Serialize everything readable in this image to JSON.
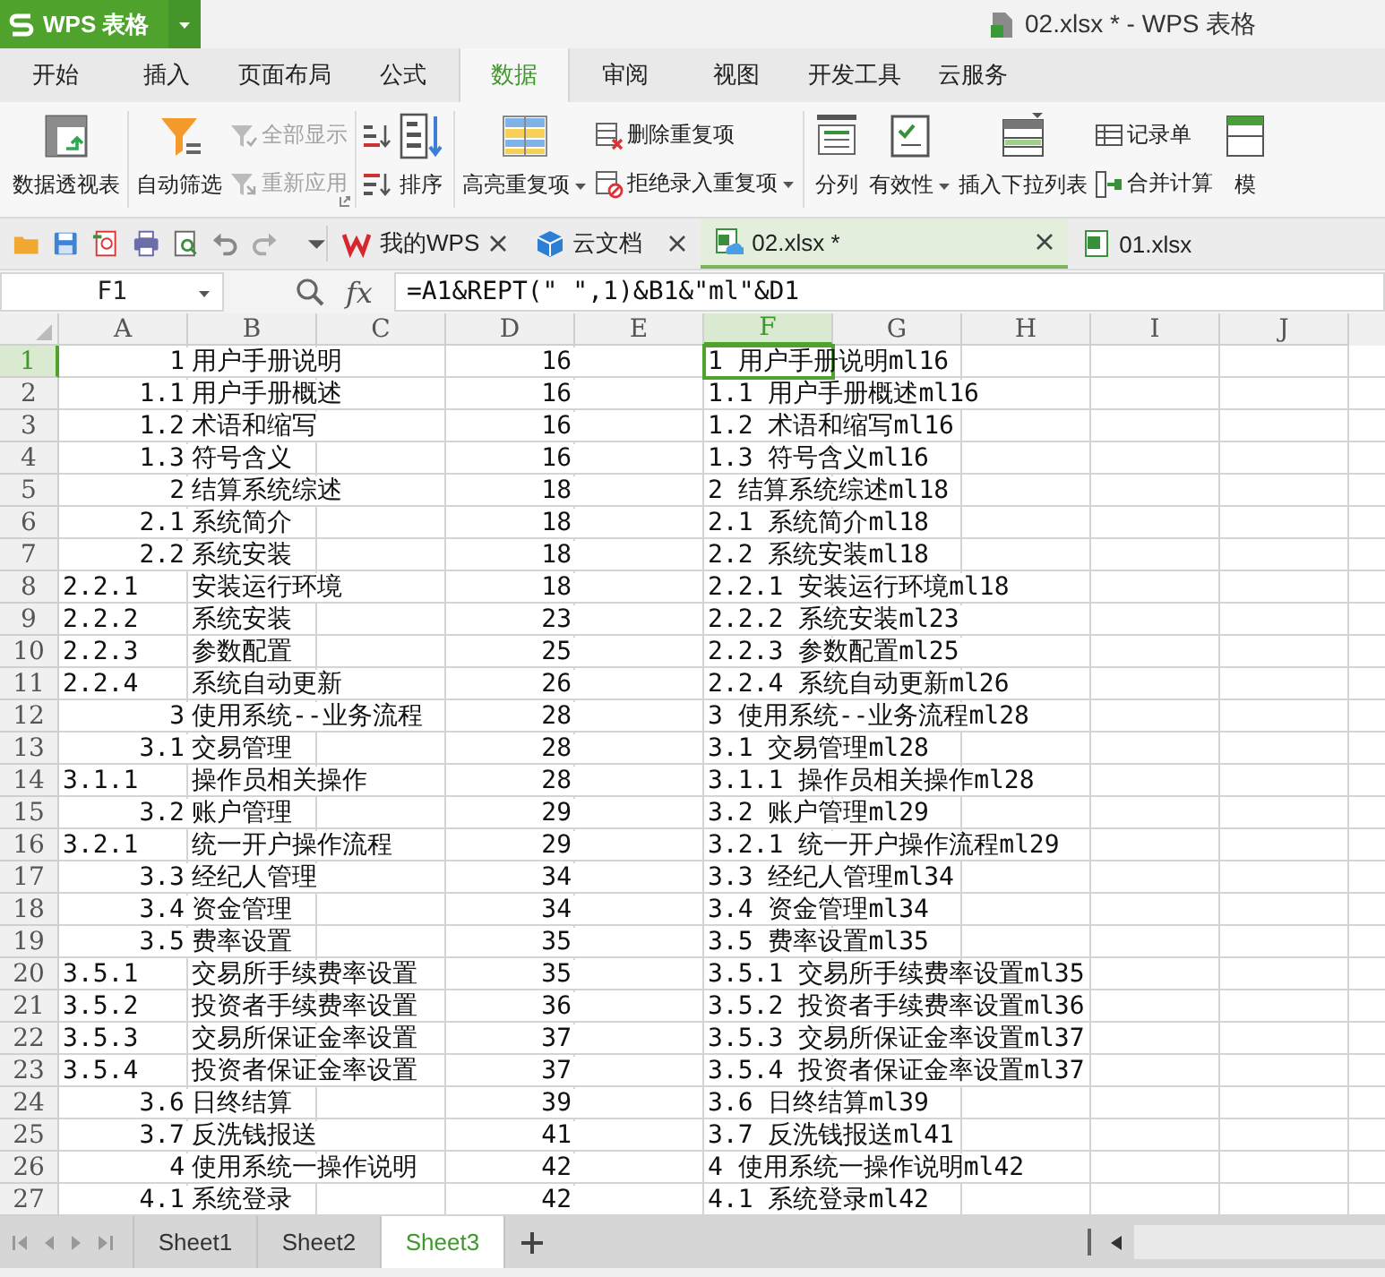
{
  "app_button": {
    "label": "WPS 表格"
  },
  "window": {
    "title": "02.xlsx * - WPS 表格"
  },
  "menu_tabs": [
    {
      "label": "开始",
      "selected": false
    },
    {
      "label": "插入",
      "selected": false
    },
    {
      "label": "页面布局",
      "selected": false
    },
    {
      "label": "公式",
      "selected": false
    },
    {
      "label": "数据",
      "selected": true
    },
    {
      "label": "审阅",
      "selected": false
    },
    {
      "label": "视图",
      "selected": false
    },
    {
      "label": "开发工具",
      "selected": false
    },
    {
      "label": "云服务",
      "selected": false
    }
  ],
  "ribbon": {
    "groups": [
      {
        "columns": [
          {
            "items": [
              {
                "kind": "large",
                "label": "数据透视表",
                "disabled": false,
                "dropdown": false
              }
            ]
          }
        ]
      },
      {
        "columns": [
          {
            "items": [
              {
                "kind": "large",
                "label": "自动筛选",
                "disabled": false,
                "dropdown": false
              }
            ]
          },
          {
            "items": [
              {
                "kind": "small",
                "label": "全部显示",
                "disabled": true,
                "dropdown": false
              },
              {
                "kind": "small",
                "label": "重新应用",
                "disabled": true,
                "dropdown": false
              }
            ]
          }
        ]
      },
      {
        "columns": [
          {
            "items": [
              {
                "kind": "icon"
              },
              {
                "kind": "icon"
              }
            ]
          },
          {
            "items": [
              {
                "kind": "large",
                "label": "排序",
                "disabled": false,
                "dropdown": false
              }
            ]
          }
        ]
      },
      {
        "columns": [
          {
            "items": [
              {
                "kind": "large",
                "label": "高亮重复项",
                "disabled": false,
                "dropdown": true
              }
            ]
          },
          {
            "items": [
              {
                "kind": "small",
                "label": "删除重复项",
                "disabled": false,
                "dropdown": false
              },
              {
                "kind": "small",
                "label": "拒绝录入重复项",
                "disabled": false,
                "dropdown": true
              }
            ]
          }
        ]
      },
      {
        "columns": [
          {
            "items": [
              {
                "kind": "large",
                "label": "分列",
                "disabled": false,
                "dropdown": false
              }
            ]
          },
          {
            "items": [
              {
                "kind": "large",
                "label": "有效性",
                "disabled": false,
                "dropdown": true
              }
            ]
          },
          {
            "items": [
              {
                "kind": "large",
                "label": "插入下拉列表",
                "disabled": false,
                "dropdown": false
              }
            ]
          },
          {
            "items": [
              {
                "kind": "small",
                "label": "记录单",
                "disabled": false,
                "dropdown": false
              },
              {
                "kind": "small",
                "label": "合并计算",
                "disabled": false,
                "dropdown": false
              }
            ]
          },
          {
            "items": [
              {
                "kind": "large",
                "label": "模",
                "disabled": false,
                "dropdown": false
              }
            ]
          }
        ]
      }
    ]
  },
  "doc_tabs": [
    {
      "label": "我的WPS",
      "selected": false,
      "closable": true
    },
    {
      "label": "云文档",
      "selected": false,
      "closable": true
    },
    {
      "label": "02.xlsx *",
      "selected": true,
      "closable": true
    },
    {
      "label": "01.xlsx",
      "selected": false,
      "closable": false
    }
  ],
  "formula_bar": {
    "name_box": "F1",
    "function_button": "fx",
    "formula": "=A1&REPT(\" \",1)&B1&\"ml\"&D1"
  },
  "columns": [
    {
      "label": "A",
      "selected": false
    },
    {
      "label": "B",
      "selected": false
    },
    {
      "label": "C",
      "selected": false
    },
    {
      "label": "D",
      "selected": false
    },
    {
      "label": "E",
      "selected": false
    },
    {
      "label": "F",
      "selected": true
    },
    {
      "label": "G",
      "selected": false
    },
    {
      "label": "H",
      "selected": false
    },
    {
      "label": "I",
      "selected": false
    },
    {
      "label": "J",
      "selected": false
    }
  ],
  "rows": [
    {
      "number": "1",
      "selected": true,
      "a": {
        "text": "1",
        "kind": "number"
      },
      "b": "用户手册说明",
      "d": "16",
      "f": "1 用户手册说明ml16"
    },
    {
      "number": "2",
      "selected": false,
      "a": {
        "text": "1.1",
        "kind": "number"
      },
      "b": "用户手册概述",
      "d": "16",
      "f": "1.1 用户手册概述ml16"
    },
    {
      "number": "3",
      "selected": false,
      "a": {
        "text": "1.2",
        "kind": "number"
      },
      "b": "术语和缩写",
      "d": "16",
      "f": "1.2 术语和缩写ml16"
    },
    {
      "number": "4",
      "selected": false,
      "a": {
        "text": "1.3",
        "kind": "number"
      },
      "b": "符号含义",
      "d": "16",
      "f": "1.3 符号含义ml16"
    },
    {
      "number": "5",
      "selected": false,
      "a": {
        "text": "2",
        "kind": "number"
      },
      "b": "结算系统综述",
      "d": "18",
      "f": "2 结算系统综述ml18"
    },
    {
      "number": "6",
      "selected": false,
      "a": {
        "text": "2.1",
        "kind": "number"
      },
      "b": "系统简介",
      "d": "18",
      "f": "2.1 系统简介ml18"
    },
    {
      "number": "7",
      "selected": false,
      "a": {
        "text": "2.2",
        "kind": "number"
      },
      "b": "系统安装",
      "d": "18",
      "f": "2.2 系统安装ml18"
    },
    {
      "number": "8",
      "selected": false,
      "a": {
        "text": "2.2.1",
        "kind": "text"
      },
      "b": "安装运行环境",
      "d": "18",
      "f": "2.2.1 安装运行环境ml18"
    },
    {
      "number": "9",
      "selected": false,
      "a": {
        "text": "2.2.2",
        "kind": "text"
      },
      "b": "系统安装",
      "d": "23",
      "f": "2.2.2 系统安装ml23"
    },
    {
      "number": "10",
      "selected": false,
      "a": {
        "text": "2.2.3",
        "kind": "text"
      },
      "b": "参数配置",
      "d": "25",
      "f": "2.2.3 参数配置ml25"
    },
    {
      "number": "11",
      "selected": false,
      "a": {
        "text": "2.2.4",
        "kind": "text"
      },
      "b": "系统自动更新",
      "d": "26",
      "f": "2.2.4 系统自动更新ml26"
    },
    {
      "number": "12",
      "selected": false,
      "a": {
        "text": "3",
        "kind": "number"
      },
      "b": "使用系统--业务流程",
      "d": "28",
      "f": "3 使用系统--业务流程ml28"
    },
    {
      "number": "13",
      "selected": false,
      "a": {
        "text": "3.1",
        "kind": "number"
      },
      "b": "交易管理",
      "d": "28",
      "f": "3.1 交易管理ml28"
    },
    {
      "number": "14",
      "selected": false,
      "a": {
        "text": "3.1.1",
        "kind": "text"
      },
      "b": "操作员相关操作",
      "d": "28",
      "f": "3.1.1 操作员相关操作ml28"
    },
    {
      "number": "15",
      "selected": false,
      "a": {
        "text": "3.2",
        "kind": "number"
      },
      "b": "账户管理",
      "d": "29",
      "f": "3.2 账户管理ml29"
    },
    {
      "number": "16",
      "selected": false,
      "a": {
        "text": "3.2.1",
        "kind": "text"
      },
      "b": "统一开户操作流程",
      "d": "29",
      "f": "3.2.1 统一开户操作流程ml29"
    },
    {
      "number": "17",
      "selected": false,
      "a": {
        "text": "3.3",
        "kind": "number"
      },
      "b": "经纪人管理",
      "d": "34",
      "f": "3.3 经纪人管理ml34"
    },
    {
      "number": "18",
      "selected": false,
      "a": {
        "text": "3.4",
        "kind": "number"
      },
      "b": "资金管理",
      "d": "34",
      "f": "3.4 资金管理ml34"
    },
    {
      "number": "19",
      "selected": false,
      "a": {
        "text": "3.5",
        "kind": "number"
      },
      "b": "费率设置",
      "d": "35",
      "f": "3.5 费率设置ml35"
    },
    {
      "number": "20",
      "selected": false,
      "a": {
        "text": "3.5.1",
        "kind": "text"
      },
      "b": "交易所手续费率设置",
      "d": "35",
      "f": "3.5.1 交易所手续费率设置ml35"
    },
    {
      "number": "21",
      "selected": false,
      "a": {
        "text": "3.5.2",
        "kind": "text"
      },
      "b": "投资者手续费率设置",
      "d": "36",
      "f": "3.5.2 投资者手续费率设置ml36"
    },
    {
      "number": "22",
      "selected": false,
      "a": {
        "text": "3.5.3",
        "kind": "text"
      },
      "b": "交易所保证金率设置",
      "d": "37",
      "f": "3.5.3 交易所保证金率设置ml37"
    },
    {
      "number": "23",
      "selected": false,
      "a": {
        "text": "3.5.4",
        "kind": "text"
      },
      "b": "投资者保证金率设置",
      "d": "37",
      "f": "3.5.4 投资者保证金率设置ml37"
    },
    {
      "number": "24",
      "selected": false,
      "a": {
        "text": "3.6",
        "kind": "number"
      },
      "b": "日终结算",
      "d": "39",
      "f": "3.6 日终结算ml39"
    },
    {
      "number": "25",
      "selected": false,
      "a": {
        "text": "3.7",
        "kind": "number"
      },
      "b": "反洗钱报送",
      "d": "41",
      "f": "3.7 反洗钱报送ml41"
    },
    {
      "number": "26",
      "selected": false,
      "a": {
        "text": "4",
        "kind": "number"
      },
      "b": "使用系统一操作说明",
      "d": "42",
      "f": "4 使用系统一操作说明ml42"
    },
    {
      "number": "27",
      "selected": false,
      "a": {
        "text": "4.1",
        "kind": "number"
      },
      "b": "系统登录",
      "d": "42",
      "f": "4.1 系统登录ml42"
    }
  ],
  "sheet_tabs": [
    {
      "label": "Sheet1",
      "selected": false
    },
    {
      "label": "Sheet2",
      "selected": false
    },
    {
      "label": "Sheet3",
      "selected": true
    }
  ]
}
